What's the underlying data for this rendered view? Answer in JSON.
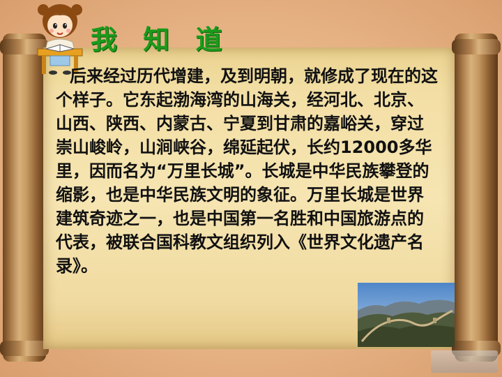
{
  "slide": {
    "heading": "我 知 道",
    "paragraph": "后来经过历代增建，及到明朝，就修成了现在的这个样子。它东起渤海湾的山海关，经河北、北京、山西、陕西、内蒙古、宁夏到甘肃的嘉峪关，穿过崇山峻岭，山涧峡谷，绵延起伏，长约12000多华里，因而名为“万里长城”。长城是中华民族攀登的缩影，也是中华民族文明的象征。万里长城是世界建筑奇迹之一，也是中国第一名胜和中国旅游点的代表，被联合国科教文组织列入《世界文化遗产名录》。"
  },
  "colors": {
    "heading": "#1b9a1b",
    "paper": "#f6e5b2",
    "background": "#e8b889",
    "roller": "#a87a48"
  },
  "icons": {
    "avatar": "reading-girl-icon",
    "photo": "great-wall-photo"
  }
}
